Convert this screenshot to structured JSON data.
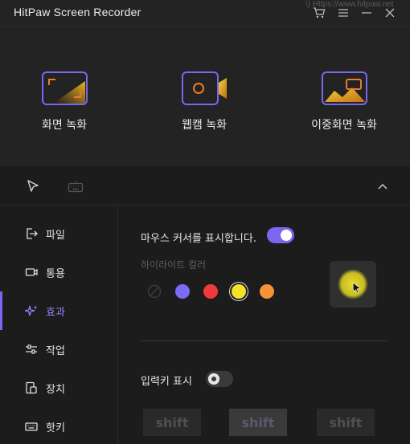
{
  "window": {
    "title": "HitPaw Screen Recorder",
    "background_text": "\\) Https://www.hitpaw.net",
    "icons": [
      "cart-icon",
      "menu-icon",
      "minimize-icon",
      "close-icon"
    ]
  },
  "modes": [
    {
      "label": "화면 녹화",
      "icon": "screen-record-icon"
    },
    {
      "label": "웹캠 녹화",
      "icon": "webcam-record-icon"
    },
    {
      "label": "이중화면 녹화",
      "icon": "dual-screen-record-icon"
    }
  ],
  "toolbar": {
    "tools": [
      "cursor-icon",
      "keyboard-icon"
    ],
    "collapse": "chevron-up-icon"
  },
  "sidebar": {
    "items": [
      {
        "label": "파일",
        "icon": "file-export-icon"
      },
      {
        "label": "통용",
        "icon": "video-icon"
      },
      {
        "label": "효과",
        "icon": "sparkle-icon",
        "active": true
      },
      {
        "label": "작업",
        "icon": "sliders-icon"
      },
      {
        "label": "장치",
        "icon": "device-icon"
      },
      {
        "label": "핫키",
        "icon": "keyboard-icon"
      }
    ]
  },
  "effects": {
    "show_cursor_label": "마우스 커서를 표시합니다.",
    "show_cursor_enabled": true,
    "highlight_color_label": "하이라이트 컬러",
    "colors": [
      "none",
      "#7b6cf6",
      "#f03a3a",
      "#f5e12a",
      "#f5923a"
    ],
    "selected_color": "#f5e12a",
    "show_keys_label": "입력키 표시",
    "show_keys_enabled": false,
    "key_previews": [
      {
        "text": "shift",
        "bg": "#2a2a2a",
        "fg": "#505050"
      },
      {
        "text": "shift",
        "bg": "#3a3a3a",
        "fg": "#5a5a70"
      },
      {
        "text": "shift",
        "bg": "#2a2a2a",
        "fg": "#505050"
      }
    ]
  },
  "colors": {
    "accent": "#7b66f0",
    "background": "#1c1c1c",
    "panel": "#232323"
  }
}
